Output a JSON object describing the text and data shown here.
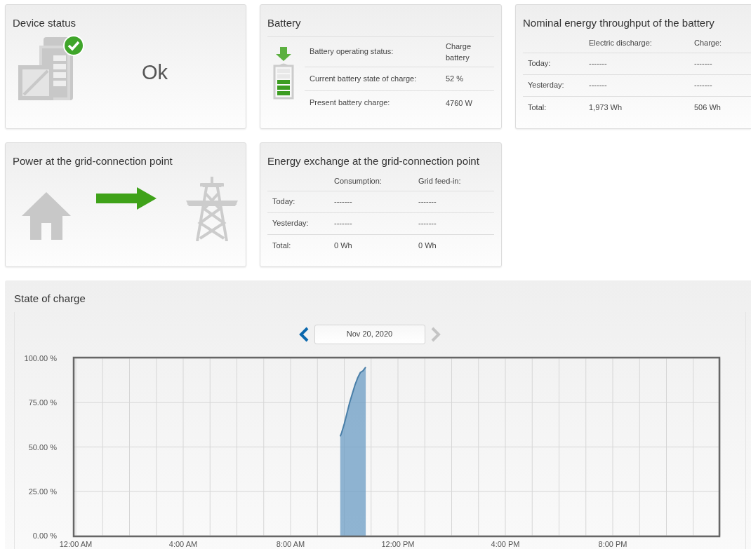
{
  "device_status": {
    "title": "Device status",
    "status": "Ok",
    "ok": true
  },
  "battery": {
    "title": "Battery",
    "charging": true,
    "rows": [
      {
        "label": "Battery operating status:",
        "value": "Charge battery"
      },
      {
        "label": "Current battery state of charge:",
        "value": "52 %"
      },
      {
        "label": "Present battery charge:",
        "value": "4760 W"
      }
    ]
  },
  "throughput": {
    "title": "Nominal energy throughput of the battery",
    "columns": [
      "Electric discharge:",
      "Charge:"
    ],
    "rows": [
      {
        "label": "Today:",
        "values": [
          "-------",
          "-------"
        ]
      },
      {
        "label": "Yesterday:",
        "values": [
          "-------",
          "-------"
        ]
      },
      {
        "label": "Total:",
        "values": [
          "1,973 Wh",
          "506 Wh"
        ]
      }
    ]
  },
  "grid_power": {
    "title": "Power at the grid-connection point"
  },
  "energy_exchange": {
    "title": "Energy exchange at the grid-connection point",
    "columns": [
      "Consumption:",
      "Grid feed-in:"
    ],
    "rows": [
      {
        "label": "Today:",
        "values": [
          "-------",
          "-------"
        ]
      },
      {
        "label": "Yesterday:",
        "values": [
          "-------",
          "-------"
        ]
      },
      {
        "label": "Total:",
        "values": [
          "0 Wh",
          "0 Wh"
        ]
      }
    ]
  },
  "soc_panel": {
    "title": "State of charge",
    "date_nav": {
      "date": "Nov 20, 2020",
      "prev_disabled": false,
      "next_disabled": true
    },
    "chart_data": {
      "type": "area",
      "grid": true,
      "xlim": [
        0,
        24
      ],
      "ylim": [
        0,
        100
      ],
      "xticks": [
        {
          "value": 0,
          "label": "12:00 AM"
        },
        {
          "value": 4,
          "label": "4:00 AM"
        },
        {
          "value": 8,
          "label": "8:00 AM"
        },
        {
          "value": 12,
          "label": "12:00 PM"
        },
        {
          "value": 16,
          "label": "4:00 PM"
        },
        {
          "value": 20,
          "label": "8:00 PM"
        }
      ],
      "yticks": [
        {
          "value": 0,
          "label": "0.00 %"
        },
        {
          "value": 25,
          "label": "25.00 %"
        },
        {
          "value": 50,
          "label": "50.00 %"
        },
        {
          "value": 75,
          "label": "75.00 %"
        },
        {
          "value": 100,
          "label": "100.00 %"
        }
      ],
      "x": [
        9.85,
        9.9,
        10.0,
        10.1,
        10.2,
        10.3,
        10.4,
        10.5,
        10.6,
        10.7,
        10.8
      ],
      "series": [
        {
          "color": "#6b9cc4",
          "values": [
            56,
            58,
            63,
            69,
            75,
            80,
            85,
            89,
            92,
            93,
            95
          ]
        }
      ]
    }
  }
}
